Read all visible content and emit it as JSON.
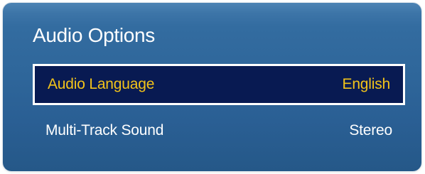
{
  "menu": {
    "title": "Audio Options",
    "items": [
      {
        "label": "Audio Language",
        "value": "English",
        "selected": true
      },
      {
        "label": "Multi-Track Sound",
        "value": "Stereo",
        "selected": false
      }
    ]
  },
  "colors": {
    "panel_top": "#4d84b4",
    "panel_bottom": "#255888",
    "highlight_bg": "#081a52",
    "highlight_text": "#f2c31a",
    "text": "#ffffff"
  }
}
